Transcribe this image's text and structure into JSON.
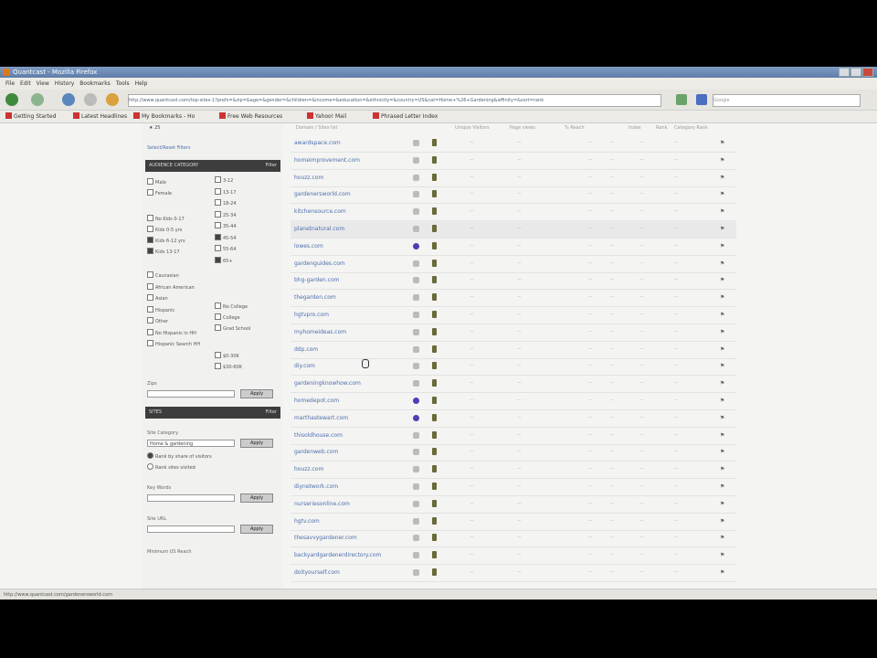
{
  "window": {
    "title": "Quantcast - Mozilla Firefox"
  },
  "menu": [
    "File",
    "Edit",
    "View",
    "History",
    "Bookmarks",
    "Tools",
    "Help"
  ],
  "nav": {
    "url": "http://www.quantcast.com/top-sites-1?prefs=&zip=&age=&gender=&children=&income=&education=&ethnicity=&country=US&cat=Home+%26+Gardening&affinity=&sort=rank",
    "search_placeholder": "Google"
  },
  "bookmarks": [
    "Getting Started",
    "Latest Headlines",
    "My Bookmarks - Ho",
    "Free Web Resources",
    "Yahoo! Mail",
    "Phrased Letter Index"
  ],
  "sidebar": {
    "favorite": "★ 25",
    "select_link": "Select/Reset Filters",
    "audience_header": "AUDIENCE CATEGORY",
    "audience_tag": "Filter",
    "gender": [
      {
        "label": "Male",
        "on": false
      },
      {
        "label": "Female",
        "on": false
      }
    ],
    "age": [
      {
        "label": "3-12",
        "on": false
      },
      {
        "label": "13-17",
        "on": false
      },
      {
        "label": "18-24",
        "on": false
      },
      {
        "label": "25-34",
        "on": false
      },
      {
        "label": "35-44",
        "on": false
      },
      {
        "label": "45-54",
        "on": true
      },
      {
        "label": "55-64",
        "on": false
      },
      {
        "label": "65+",
        "on": true
      }
    ],
    "kids": [
      {
        "label": "No Kids 0-17",
        "on": false
      },
      {
        "label": "Kids 0-5 yrs",
        "on": false
      },
      {
        "label": "Kids 6-12 yrs",
        "on": true
      },
      {
        "label": "Kids 13-17",
        "on": true
      }
    ],
    "income": [
      {
        "label": "Caucasian",
        "on": false
      },
      {
        "label": "African American",
        "on": false
      },
      {
        "label": "Asian",
        "on": false
      },
      {
        "label": "Hispanic",
        "on": false
      },
      {
        "label": "Other",
        "on": false
      }
    ],
    "education": [
      {
        "label": "No College",
        "on": false
      },
      {
        "label": "College",
        "on": false
      },
      {
        "label": "Grad School",
        "on": false
      }
    ],
    "ethnic": [
      {
        "label": "No Hispanic in HH",
        "on": false
      },
      {
        "label": "Hispanic Search HH",
        "on": false
      }
    ],
    "extra": [
      {
        "label": "$0-30K",
        "on": false
      },
      {
        "label": "$30-60K",
        "on": false
      }
    ],
    "zip_label": "Zips",
    "zip_button": "Apply",
    "sites_header": "SITES",
    "sites_tag": "Filter",
    "category_label": "Site Category",
    "category_value": "Home & gardening",
    "category_button": "Apply",
    "radio1": "Rank by share of visitors",
    "radio2": "Rank sites visited",
    "keywords_label": "Key Words",
    "keywords_button": "Apply",
    "url_label": "Site URL",
    "url_button": "Apply",
    "more_label": "Minimum US Reach"
  },
  "table": {
    "headers": [
      "Domain / Sites list",
      "",
      "",
      "Unique Visitors",
      "Page views",
      "% Reach",
      "",
      "Index",
      "Rank",
      "Category Rank"
    ],
    "rows": [
      {
        "domain": "awardspace.com",
        "blue": false
      },
      {
        "domain": "homeimprovement.com",
        "blue": false
      },
      {
        "domain": "houzz.com",
        "blue": false
      },
      {
        "domain": "gardenersworld.com",
        "blue": false
      },
      {
        "domain": "kitchensource.com",
        "blue": false
      },
      {
        "domain": "planetnatural.com",
        "blue": false,
        "hl": true
      },
      {
        "domain": "lowes.com",
        "blue": true
      },
      {
        "domain": "gardenguides.com",
        "blue": false
      },
      {
        "domain": "bhg-garden.com",
        "blue": false
      },
      {
        "domain": "thegarden.com",
        "blue": false
      },
      {
        "domain": "hgtvpro.com",
        "blue": false
      },
      {
        "domain": "myhomeideas.com",
        "blue": false
      },
      {
        "domain": "ddp.com",
        "blue": false
      },
      {
        "domain": "diy.com",
        "blue": false
      },
      {
        "domain": "gardeningknowhow.com",
        "blue": false
      },
      {
        "domain": "homedepot.com",
        "blue": true
      },
      {
        "domain": "marthastewart.com",
        "blue": true
      },
      {
        "domain": "thisoldhouse.com",
        "blue": false
      },
      {
        "domain": "gardenweb.com",
        "blue": false
      },
      {
        "domain": "houzz.com",
        "blue": false
      },
      {
        "domain": "diynetwork.com",
        "blue": false
      },
      {
        "domain": "nurseriesonline.com",
        "blue": false
      },
      {
        "domain": "hgtv.com",
        "blue": false
      },
      {
        "domain": "thesavvygardener.com",
        "blue": false
      },
      {
        "domain": "backyardgardenerdirectory.com",
        "blue": false
      },
      {
        "domain": "doityourself.com",
        "blue": false
      }
    ]
  },
  "status": "http://www.quantcast.com/gardenersworld.com",
  "colors": {
    "accent": "#4d6fae",
    "header_bar": "#3d3d3d",
    "titlebar": "#5d7ca8"
  }
}
